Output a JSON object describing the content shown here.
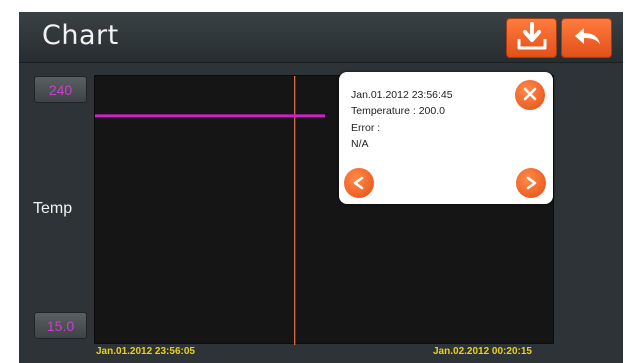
{
  "header": {
    "title": "Chart"
  },
  "y_axis": {
    "label": "Temp",
    "max": "240",
    "min": "15.0"
  },
  "x_axis": {
    "start": "Jan.01.2012 23:56:05",
    "end": "Jan.02.2012 00:20:15"
  },
  "popup": {
    "time": "Jan.01.2012 23:56:45",
    "temperature": "Temperature : 200.0",
    "error_label": "Error :",
    "error_value": "N/A"
  },
  "colors": {
    "accent": "#f26522",
    "series": "#cc22cc",
    "cursor": "#e8764a",
    "axis_text": "#e8d21a"
  },
  "icons": {
    "download": "download-icon",
    "back": "back-arrow-icon",
    "close": "close-icon",
    "prev": "chevron-left-icon",
    "next": "chevron-right-icon"
  },
  "chart_data": {
    "type": "line",
    "x_range": [
      "Jan.01.2012 23:56:05",
      "Jan.02.2012 00:20:15"
    ],
    "ylim": [
      15.0,
      240
    ],
    "series": [
      {
        "x": [
          "Jan.01.2012 23:56:05",
          "Jan.01.2012 00:08:00"
        ],
        "values": [
          200.0,
          200.0
        ]
      }
    ],
    "cursor": {
      "x": "Jan.01.2012 23:56:45",
      "value": 200.0
    }
  }
}
